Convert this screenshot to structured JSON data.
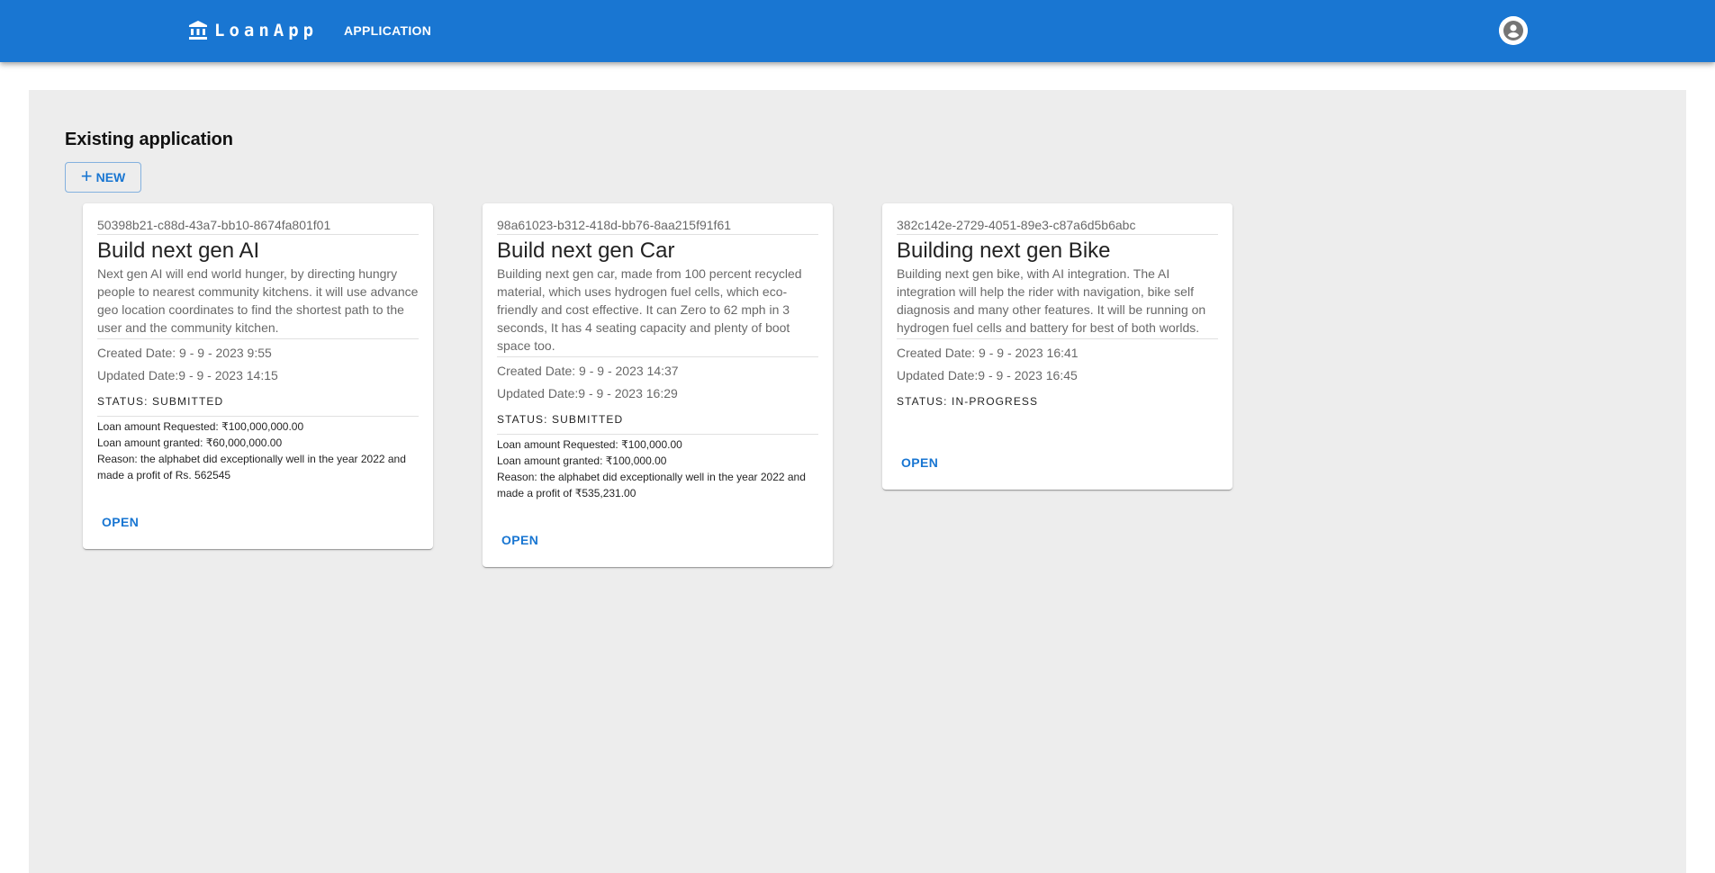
{
  "header": {
    "brand": "LoanApp",
    "nav_item": "APPLICATION",
    "brand_icon": "bank-icon",
    "avatar_icon": "account-circle-icon",
    "bar_color": "#1976d2"
  },
  "main": {
    "title": "Existing application",
    "new_button": "NEW"
  },
  "applications": [
    {
      "id": "50398b21-c88d-43a7-bb10-8674fa801f01",
      "title": "Build next gen AI",
      "description": "Next gen AI will end world hunger, by directing hungry people to nearest community kitchens. it will use advance geo location coordinates to find the shortest path to the user and the community kitchen.",
      "created": "Created Date: 9 - 9 - 2023 9:55",
      "updated": "Updated Date:9 - 9 - 2023 14:15",
      "status": "STATUS: SUBMITTED",
      "requested": "Loan amount Requested:  ₹100,000,000.00",
      "granted": "Loan amount granted:  ₹60,000,000.00",
      "reason": "Reason:  the alphabet did exceptionally well in the year 2022 and made a profit of Rs. 562545",
      "open": "OPEN"
    },
    {
      "id": "98a61023-b312-418d-bb76-8aa215f91f61",
      "title": "Build next gen Car",
      "description": "Building next gen car, made from 100 percent recycled material, which uses hydrogen fuel cells, which eco-friendly and cost effective. It can Zero to 62 mph in 3 seconds, It has 4 seating capacity and plenty of boot space too.",
      "created": "Created Date: 9 - 9 - 2023 14:37",
      "updated": "Updated Date:9 - 9 - 2023 16:29",
      "status": "STATUS: SUBMITTED",
      "requested": "Loan amount Requested:  ₹100,000.00",
      "granted": "Loan amount granted:  ₹100,000.00",
      "reason": "Reason:  the alphabet did exceptionally well in the year 2022 and made a profit of ₹535,231.00",
      "open": "OPEN"
    },
    {
      "id": "382c142e-2729-4051-89e3-c87a6d5b6abc",
      "title": "Building next gen Bike",
      "description": "Building next gen bike, with AI integration. The AI integration will help the rider with navigation, bike self diagnosis and many other features. It will be running on hydrogen fuel cells and battery for best of both worlds.",
      "created": "Created Date: 9 - 9 - 2023 16:41",
      "updated": "Updated Date:9 - 9 - 2023 16:45",
      "status": "STATUS: IN-PROGRESS",
      "open": "OPEN"
    }
  ]
}
